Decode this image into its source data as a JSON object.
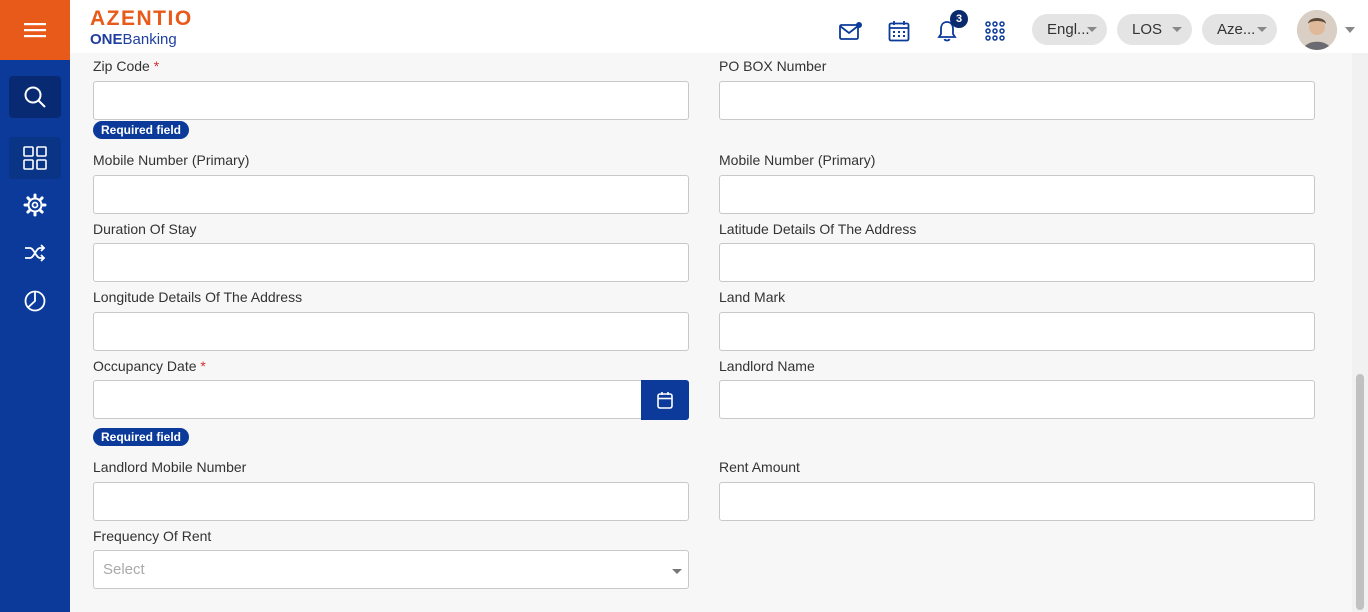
{
  "app": {
    "logo_main": "AZENTIO",
    "logo_sub_bold": "ONE",
    "logo_sub": "Banking",
    "brand_orange": "#e85a1a",
    "brand_blue": "#0b3a9a"
  },
  "sidebar": {
    "items": [
      {
        "icon": "search-icon"
      },
      {
        "icon": "apps-grid-icon"
      },
      {
        "icon": "settings-gear-icon"
      },
      {
        "icon": "shuffle-icon"
      },
      {
        "icon": "pie-chart-icon"
      }
    ]
  },
  "header": {
    "notification_count": "3",
    "language": "Engl...",
    "module": "LOS",
    "entity": "Aze..."
  },
  "form": {
    "zip_code_label": "Zip Code",
    "po_box_label": "PO BOX Number",
    "required_text": "Required field",
    "mobile_primary_label": "Mobile Number (Primary)",
    "mobile_primary_label_2": "Mobile Number (Primary)",
    "duration_label": "Duration Of Stay",
    "latitude_label": "Latitude Details Of The Address",
    "longitude_label": "Longitude Details Of The Address",
    "landmark_label": "Land Mark",
    "occupancy_label": "Occupancy Date",
    "landlord_name_label": "Landlord Name",
    "landlord_mobile_label": "Landlord Mobile Number",
    "rent_amount_label": "Rent Amount",
    "frequency_label": "Frequency Of Rent",
    "frequency_placeholder": "Select",
    "required_star": "*"
  }
}
